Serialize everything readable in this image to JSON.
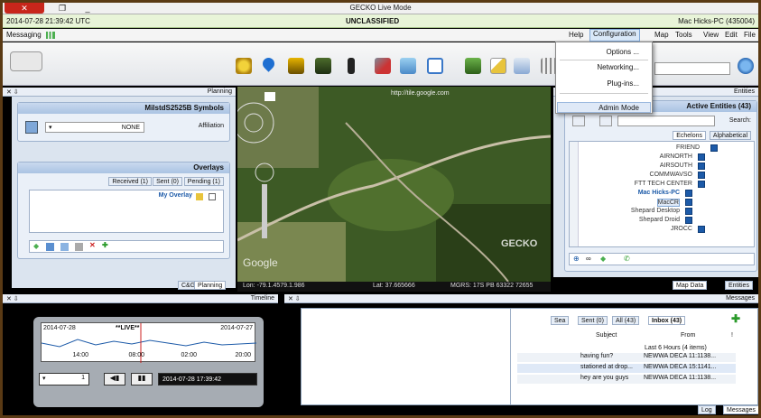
{
  "window": {
    "title": "GECKO   Live Mode",
    "close": "✕",
    "max": "❐",
    "min": "_"
  },
  "classification": {
    "time": "2014-07-28 21:39:42 UTC",
    "label": "UNCLASSIFIED",
    "host": "Mac Hicks-PC (435004)"
  },
  "menu": {
    "items": [
      "File",
      "Edit",
      "View",
      "Tools",
      "Map",
      "Configuration",
      "Help"
    ],
    "messaging": "Messaging"
  },
  "config_menu": {
    "options": "Options ...",
    "networking": "Networking...",
    "plugins": "Plug-ins...",
    "admin": "Admin Mode"
  },
  "planning": {
    "pane_title": "Planning",
    "milstd_title": "MilstdS2525B Symbols",
    "affiliation_label": "Affiliation",
    "affiliation_value": "NONE",
    "overlays_title": "Overlays",
    "tabs": [
      "Pending (1)",
      "Sent (0)",
      "Received (1)"
    ],
    "overlay_item": "My Overlay",
    "bottom_tabs": [
      "Planning",
      "C&G"
    ]
  },
  "map": {
    "attribution": "http://tile.google.com",
    "watermark": "Google",
    "logo": "GECKO",
    "status": {
      "mgrs": "MGRS: 17S PB 63322 72655",
      "lat": "Lat: 37.665666",
      "lon": "Lon: -79.1.4579.1.986"
    }
  },
  "entities": {
    "pane_title": "Entities",
    "box_title": "Active Entities (43)",
    "search_label": "Search:",
    "tabs": [
      "Alphabetical",
      "Echelons"
    ],
    "tree": [
      "FRIEND",
      "AIRNORTH",
      "AIRSOUTH",
      "COMMWAVSO",
      "FTT TECH CENTER",
      "Mac Hicks-PC",
      "MacCR",
      "Shepard Desktop",
      "Shepard Droid",
      "JROCC"
    ],
    "bottom_tabs": [
      "Entities",
      "Map Data"
    ]
  },
  "timeline": {
    "pane_title": "Timeline",
    "left_date": "2014-07-27",
    "right_date": "2014-07-28",
    "live": "**LIVE**",
    "times": [
      "20:00",
      "02:00",
      "08:00",
      "14:00"
    ],
    "current": "2014-07-28 17:39:42",
    "speed": "1"
  },
  "messages": {
    "pane_title": "Messages",
    "tabs": [
      "Inbox (43)",
      "All (43)",
      "Sent (0)",
      "Sea"
    ],
    "cols": [
      "!",
      "From",
      "Subject"
    ],
    "group": "Last 6 Hours (4 items)",
    "rows": [
      {
        "from": "NEWWA DECA 11:1138...",
        "subject": "having fun?"
      },
      {
        "from": "NEWWA DECA 15:1141...",
        "subject": "stationed at drop..."
      },
      {
        "from": "NEWWA DECA 11:1138...",
        "subject": "hey are you guys"
      }
    ],
    "bottom_tabs": [
      "Messages",
      "Log"
    ]
  },
  "colors": {
    "accent": "#1c5aa8",
    "close_red": "#c8261b",
    "class_green": "#e8f4d8",
    "frame_brown": "#5a3a14"
  }
}
